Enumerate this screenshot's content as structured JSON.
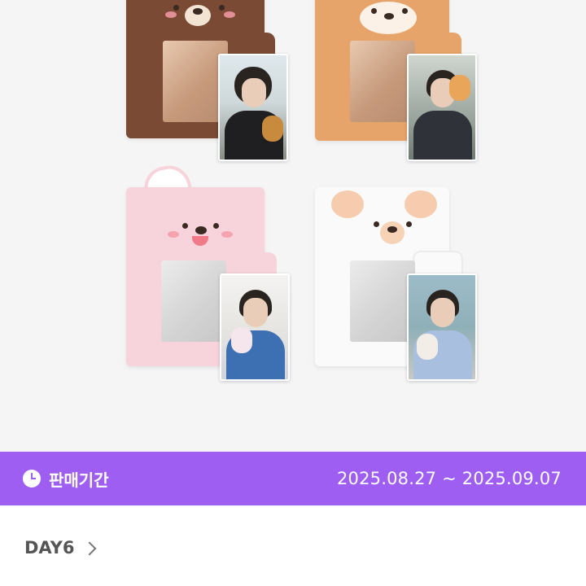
{
  "product_gallery": {
    "holders": [
      {
        "animal": "bear",
        "color": "#7a4a34"
      },
      {
        "animal": "shiba",
        "color": "#e7a46a"
      },
      {
        "animal": "bunny",
        "color": "#f7d3dc"
      },
      {
        "animal": "puppy",
        "color": "#fbfafa"
      }
    ]
  },
  "sale_banner": {
    "icon": "clock-icon",
    "label": "판매기간",
    "period": "2025.08.27 ~ 2025.09.07",
    "background": "#9f5ef2"
  },
  "artist": {
    "name": "DAY6",
    "icon": "chevron-right-icon"
  }
}
